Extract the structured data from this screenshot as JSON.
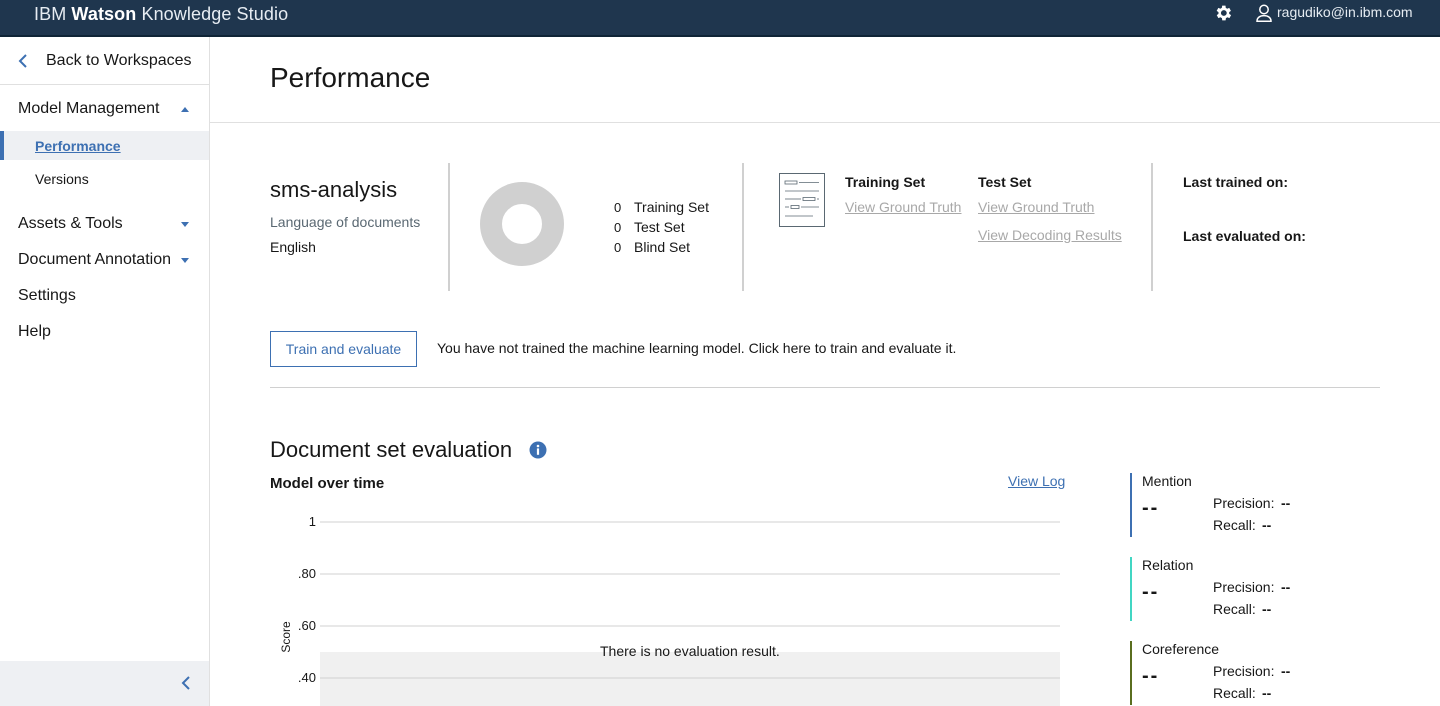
{
  "app": {
    "brand_prefix": "IBM",
    "brand_bold": "Watson",
    "brand_suffix": "Knowledge Studio",
    "user_email": "ragudiko@in.ibm.com"
  },
  "sidebar": {
    "back_label": "Back to Workspaces",
    "sections": [
      {
        "label": "Model Management",
        "expanded": true
      },
      {
        "label": "Assets & Tools",
        "expanded": false
      },
      {
        "label": "Document Annotation",
        "expanded": false
      },
      {
        "label": "Settings"
      },
      {
        "label": "Help"
      }
    ],
    "sub_items": [
      {
        "label": "Performance",
        "active": true
      },
      {
        "label": "Versions",
        "active": false
      }
    ]
  },
  "page": {
    "title": "Performance"
  },
  "project": {
    "name": "sms-analysis",
    "language_label": "Language of documents",
    "language_value": "English"
  },
  "sets": {
    "counts": [
      {
        "count": "0",
        "label": "Training Set"
      },
      {
        "count": "0",
        "label": "Test Set"
      },
      {
        "count": "0",
        "label": "Blind Set"
      }
    ],
    "training": {
      "heading": "Training Set",
      "link_ground_truth": "View Ground Truth"
    },
    "test": {
      "heading": "Test Set",
      "link_ground_truth": "View Ground Truth",
      "link_decoding": "View Decoding Results"
    }
  },
  "status": {
    "last_trained_label": "Last trained on:",
    "last_evaluated_label": "Last evaluated on:"
  },
  "train": {
    "button_label": "Train and evaluate",
    "message": "You have not trained the machine learning model. Click here to train and evaluate it."
  },
  "evaluation": {
    "title": "Document set evaluation",
    "chart_title": "Model over time",
    "view_log_label": "View Log",
    "y_axis_label": "Score",
    "empty_message": "There is no evaluation result.",
    "metrics": [
      {
        "name": "Mention",
        "value": "--",
        "precision_label": "Precision:",
        "precision": "--",
        "recall_label": "Recall:",
        "recall": "--",
        "color": "#3d70b2"
      },
      {
        "name": "Relation",
        "value": "--",
        "precision_label": "Precision:",
        "precision": "--",
        "recall_label": "Recall:",
        "recall": "--",
        "color": "#41d6c3"
      },
      {
        "name": "Coreference",
        "value": "--",
        "precision_label": "Precision:",
        "precision": "--",
        "recall_label": "Recall:",
        "recall": "--",
        "color": "#5a6e1f"
      }
    ]
  },
  "chart_data": {
    "type": "line",
    "title": "Model over time",
    "xlabel": "",
    "ylabel": "Score",
    "y_ticks": [
      "1",
      ".80",
      ".60",
      ".40"
    ],
    "ylim": [
      0.4,
      1
    ],
    "series": [],
    "grid": true,
    "annotations": [
      "There is no evaluation result."
    ]
  },
  "colors": {
    "topbar": "#1f364e",
    "accent": "#3d70b2",
    "donut_empty": "#d0d0d0"
  }
}
